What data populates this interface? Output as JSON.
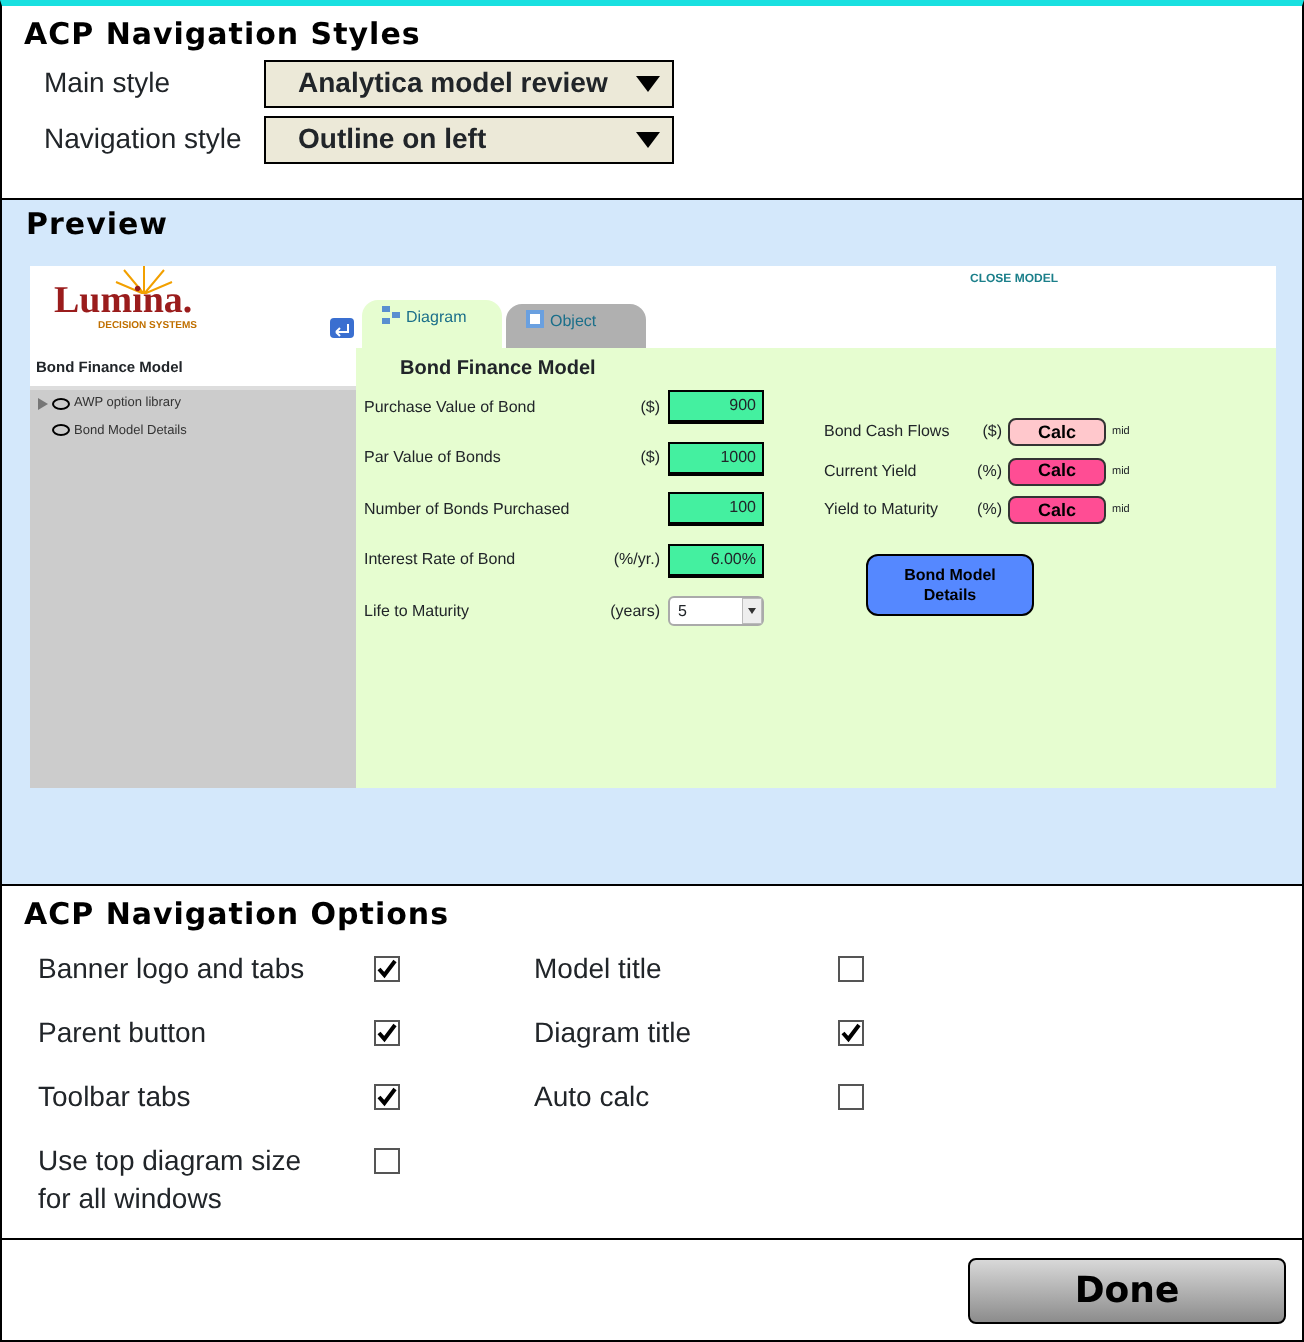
{
  "styles": {
    "title": "ACP Navigation Styles",
    "fields": [
      {
        "label": "Main style",
        "value": "Analytica model review"
      },
      {
        "label": "Navigation style",
        "value": "Outline on left"
      }
    ]
  },
  "preview": {
    "title": "Preview",
    "logo": {
      "name": "Lumina.",
      "tagline": "DECISION SYSTEMS"
    },
    "close_link": "CLOSE MODEL",
    "tabs": [
      {
        "label": "Diagram",
        "selected": true
      },
      {
        "label": "Object",
        "selected": false
      }
    ],
    "outline": {
      "title": "Bond Finance Model",
      "items": [
        {
          "label": "AWP option library",
          "expanded": false
        },
        {
          "label": "Bond Model Details"
        }
      ]
    },
    "diagram": {
      "title": "Bond Finance Model",
      "inputs": [
        {
          "label": "Purchase Value of Bond",
          "unit": "($)",
          "value": "900",
          "kind": "field"
        },
        {
          "label": "Par Value of Bonds",
          "unit": "($)",
          "value": "1000",
          "kind": "field"
        },
        {
          "label": "Number of Bonds Purchased",
          "value": "100",
          "kind": "field"
        },
        {
          "label": "Interest Rate of Bond",
          "unit": "(%/yr.)",
          "value": "6.00%",
          "kind": "field"
        },
        {
          "label": "Life to Maturity",
          "unit": "(years)",
          "value": "5",
          "kind": "dropdown"
        }
      ],
      "outputs": [
        {
          "label": "Bond Cash Flows",
          "unit": "($)",
          "button": "Calc",
          "color": "#ffc8cc",
          "note": "mid"
        },
        {
          "label": "Current Yield",
          "unit": "(%)",
          "button": "Calc",
          "color": "#ff4d94",
          "note": "mid"
        },
        {
          "label": "Yield to Maturity",
          "unit": "(%)",
          "button": "Calc",
          "color": "#ff4d94",
          "note": "mid"
        }
      ],
      "details_button": "Bond Model\nDetails"
    }
  },
  "options": {
    "title": "ACP Navigation Options",
    "items": [
      {
        "label": "Banner logo and tabs",
        "checked": true
      },
      {
        "label": "Model title",
        "checked": false
      },
      {
        "label": "Parent button",
        "checked": true
      },
      {
        "label": "Diagram title",
        "checked": true
      },
      {
        "label": "Toolbar tabs",
        "checked": true
      },
      {
        "label": "Auto calc",
        "checked": false
      },
      {
        "label": "Use top diagram size\nfor all windows",
        "checked": false
      }
    ]
  },
  "done_button": "Done"
}
